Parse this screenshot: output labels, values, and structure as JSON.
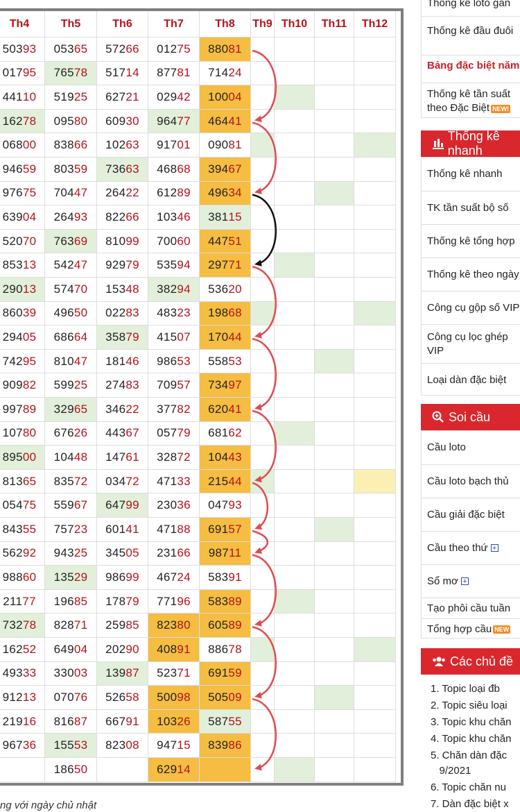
{
  "table": {
    "headers": [
      "Th4",
      "Th5",
      "Th6",
      "Th7",
      "Th8",
      "Th9",
      "Th10",
      "Th11",
      "Th12"
    ],
    "rows": [
      [
        {
          "v": "50393",
          "h": ""
        },
        {
          "v": "05365",
          "h": ""
        },
        {
          "v": "57266",
          "h": ""
        },
        {
          "v": "01275",
          "h": ""
        },
        {
          "v": "88081",
          "h": "gold"
        }
      ],
      [
        {
          "v": "01795",
          "h": ""
        },
        {
          "v": "76578",
          "h": "green"
        },
        {
          "v": "51714",
          "h": ""
        },
        {
          "v": "87781",
          "h": ""
        },
        {
          "v": "71424",
          "h": ""
        }
      ],
      [
        {
          "v": "44110",
          "h": ""
        },
        {
          "v": "51925",
          "h": ""
        },
        {
          "v": "62721",
          "h": ""
        },
        {
          "v": "02942",
          "h": ""
        },
        {
          "v": "10004",
          "h": "gold"
        }
      ],
      [
        {
          "v": "16278",
          "h": "green"
        },
        {
          "v": "09580",
          "h": ""
        },
        {
          "v": "60930",
          "h": ""
        },
        {
          "v": "96477",
          "h": "green"
        },
        {
          "v": "46441",
          "h": "gold"
        }
      ],
      [
        {
          "v": "06800",
          "h": ""
        },
        {
          "v": "83866",
          "h": ""
        },
        {
          "v": "10263",
          "h": ""
        },
        {
          "v": "91701",
          "h": ""
        },
        {
          "v": "09081",
          "h": ""
        }
      ],
      [
        {
          "v": "94659",
          "h": ""
        },
        {
          "v": "80359",
          "h": ""
        },
        {
          "v": "73663",
          "h": "green"
        },
        {
          "v": "46868",
          "h": ""
        },
        {
          "v": "39467",
          "h": "gold"
        }
      ],
      [
        {
          "v": "97675",
          "h": ""
        },
        {
          "v": "70447",
          "h": ""
        },
        {
          "v": "26422",
          "h": ""
        },
        {
          "v": "61289",
          "h": ""
        },
        {
          "v": "49634",
          "h": "gold"
        }
      ],
      [
        {
          "v": "63904",
          "h": ""
        },
        {
          "v": "26493",
          "h": ""
        },
        {
          "v": "82266",
          "h": ""
        },
        {
          "v": "10346",
          "h": ""
        },
        {
          "v": "38115",
          "h": "green"
        }
      ],
      [
        {
          "v": "52070",
          "h": ""
        },
        {
          "v": "76369",
          "h": "green"
        },
        {
          "v": "81099",
          "h": ""
        },
        {
          "v": "70060",
          "h": ""
        },
        {
          "v": "44751",
          "h": "gold"
        }
      ],
      [
        {
          "v": "85313",
          "h": ""
        },
        {
          "v": "54247",
          "h": ""
        },
        {
          "v": "92979",
          "h": ""
        },
        {
          "v": "53594",
          "h": ""
        },
        {
          "v": "29771",
          "h": "gold"
        }
      ],
      [
        {
          "v": "29013",
          "h": "green"
        },
        {
          "v": "57470",
          "h": ""
        },
        {
          "v": "15348",
          "h": ""
        },
        {
          "v": "38294",
          "h": "green"
        },
        {
          "v": "53620",
          "h": ""
        }
      ],
      [
        {
          "v": "86039",
          "h": ""
        },
        {
          "v": "49650",
          "h": ""
        },
        {
          "v": "02283",
          "h": ""
        },
        {
          "v": "48323",
          "h": ""
        },
        {
          "v": "19868",
          "h": "gold"
        }
      ],
      [
        {
          "v": "29405",
          "h": ""
        },
        {
          "v": "68664",
          "h": ""
        },
        {
          "v": "35879",
          "h": "green"
        },
        {
          "v": "41507",
          "h": ""
        },
        {
          "v": "17044",
          "h": "gold"
        }
      ],
      [
        {
          "v": "74295",
          "h": ""
        },
        {
          "v": "81047",
          "h": ""
        },
        {
          "v": "18146",
          "h": ""
        },
        {
          "v": "98653",
          "h": ""
        },
        {
          "v": "55853",
          "h": ""
        }
      ],
      [
        {
          "v": "90982",
          "h": ""
        },
        {
          "v": "59925",
          "h": ""
        },
        {
          "v": "27483",
          "h": ""
        },
        {
          "v": "70957",
          "h": ""
        },
        {
          "v": "73497",
          "h": "gold"
        }
      ],
      [
        {
          "v": "99789",
          "h": ""
        },
        {
          "v": "32965",
          "h": "green"
        },
        {
          "v": "34622",
          "h": ""
        },
        {
          "v": "37782",
          "h": ""
        },
        {
          "v": "62041",
          "h": "gold"
        }
      ],
      [
        {
          "v": "10780",
          "h": ""
        },
        {
          "v": "67626",
          "h": ""
        },
        {
          "v": "44367",
          "h": ""
        },
        {
          "v": "05779",
          "h": ""
        },
        {
          "v": "68162",
          "h": ""
        }
      ],
      [
        {
          "v": "89500",
          "h": "green"
        },
        {
          "v": "10448",
          "h": ""
        },
        {
          "v": "14761",
          "h": ""
        },
        {
          "v": "32872",
          "h": ""
        },
        {
          "v": "10443",
          "h": "gold"
        }
      ],
      [
        {
          "v": "81365",
          "h": ""
        },
        {
          "v": "83572",
          "h": ""
        },
        {
          "v": "03472",
          "h": ""
        },
        {
          "v": "47133",
          "h": ""
        },
        {
          "v": "21544",
          "h": "gold"
        }
      ],
      [
        {
          "v": "05475",
          "h": ""
        },
        {
          "v": "55967",
          "h": ""
        },
        {
          "v": "64799",
          "h": "green"
        },
        {
          "v": "23036",
          "h": ""
        },
        {
          "v": "04793",
          "h": ""
        }
      ],
      [
        {
          "v": "84355",
          "h": ""
        },
        {
          "v": "75723",
          "h": ""
        },
        {
          "v": "60141",
          "h": ""
        },
        {
          "v": "47188",
          "h": ""
        },
        {
          "v": "69157",
          "h": "gold"
        }
      ],
      [
        {
          "v": "56292",
          "h": ""
        },
        {
          "v": "94325",
          "h": ""
        },
        {
          "v": "34505",
          "h": ""
        },
        {
          "v": "23166",
          "h": ""
        },
        {
          "v": "98711",
          "h": "gold"
        }
      ],
      [
        {
          "v": "98860",
          "h": ""
        },
        {
          "v": "13529",
          "h": "green"
        },
        {
          "v": "98699",
          "h": ""
        },
        {
          "v": "46724",
          "h": ""
        },
        {
          "v": "58391",
          "h": ""
        }
      ],
      [
        {
          "v": "21177",
          "h": ""
        },
        {
          "v": "19685",
          "h": ""
        },
        {
          "v": "17879",
          "h": ""
        },
        {
          "v": "77196",
          "h": ""
        },
        {
          "v": "58389",
          "h": "gold"
        }
      ],
      [
        {
          "v": "73278",
          "h": "green"
        },
        {
          "v": "82871",
          "h": ""
        },
        {
          "v": "25985",
          "h": ""
        },
        {
          "v": "82380",
          "h": "gold"
        },
        {
          "v": "60589",
          "h": "gold"
        }
      ],
      [
        {
          "v": "16252",
          "h": ""
        },
        {
          "v": "64904",
          "h": ""
        },
        {
          "v": "20290",
          "h": ""
        },
        {
          "v": "40891",
          "h": "gold"
        },
        {
          "v": "88678",
          "h": ""
        }
      ],
      [
        {
          "v": "49333",
          "h": ""
        },
        {
          "v": "33003",
          "h": ""
        },
        {
          "v": "13987",
          "h": "green"
        },
        {
          "v": "52371",
          "h": ""
        },
        {
          "v": "69159",
          "h": "gold"
        }
      ],
      [
        {
          "v": "91213",
          "h": ""
        },
        {
          "v": "07076",
          "h": ""
        },
        {
          "v": "52658",
          "h": ""
        },
        {
          "v": "50098",
          "h": "gold"
        },
        {
          "v": "50509",
          "h": "gold"
        }
      ],
      [
        {
          "v": "21916",
          "h": ""
        },
        {
          "v": "81687",
          "h": ""
        },
        {
          "v": "66791",
          "h": ""
        },
        {
          "v": "10326",
          "h": "gold"
        },
        {
          "v": "58755",
          "h": "green"
        }
      ],
      [
        {
          "v": "96736",
          "h": ""
        },
        {
          "v": "15553",
          "h": "green"
        },
        {
          "v": "82308",
          "h": ""
        },
        {
          "v": "94715",
          "h": ""
        },
        {
          "v": "83986",
          "h": "gold"
        }
      ],
      [
        {
          "v": "",
          "h": ""
        },
        {
          "v": "18650",
          "h": ""
        },
        {
          "v": "",
          "h": ""
        },
        {
          "v": "62914",
          "h": "gold"
        },
        {
          "v": "",
          "h": "gold"
        }
      ]
    ],
    "extra_highlights": [
      {
        "row": 0,
        "col": 5,
        "h": ""
      },
      {
        "row": 2,
        "col": 6,
        "h": "green"
      },
      {
        "row": 4,
        "col": 5,
        "h": "green"
      },
      {
        "row": 4,
        "col": 8,
        "h": "green"
      },
      {
        "row": 6,
        "col": 7,
        "h": "green"
      },
      {
        "row": 9,
        "col": 6,
        "h": "green"
      },
      {
        "row": 11,
        "col": 5,
        "h": "green"
      },
      {
        "row": 11,
        "col": 8,
        "h": "green"
      },
      {
        "row": 13,
        "col": 7,
        "h": "green"
      },
      {
        "row": 16,
        "col": 6,
        "h": "green"
      },
      {
        "row": 18,
        "col": 5,
        "h": "green"
      },
      {
        "row": 18,
        "col": 8,
        "h": "light"
      },
      {
        "row": 20,
        "col": 7,
        "h": "green"
      },
      {
        "row": 23,
        "col": 6,
        "h": "green"
      },
      {
        "row": 25,
        "col": 5,
        "h": "green"
      },
      {
        "row": 25,
        "col": 8,
        "h": "green"
      },
      {
        "row": 27,
        "col": 7,
        "h": "green"
      },
      {
        "row": 30,
        "col": 6,
        "h": "green"
      }
    ],
    "arrow_colors": {
      "red": "#e04a4f",
      "black": "#111111"
    }
  },
  "footnote": "ng với ngày chủ nhật",
  "sidebar": {
    "top_rows": [
      {
        "label": "Thống kê loto gan",
        "red": false
      },
      {
        "label": "Thống kê đầu đuôi",
        "red": false
      },
      {
        "label": "Bảng đặc biệt năm",
        "red": true
      },
      {
        "label": "Thống kê tần suất theo Đặc Biệt",
        "red": false,
        "badge": "NEW!"
      }
    ],
    "stats_header": "Thống kê nhanh",
    "stats_items": [
      "Thống kê nhanh",
      "TK tần suất bộ số",
      "Thống kê tổng hợp",
      "Thống kê theo ngày",
      "Công cụ gộp số VIP",
      "Công cụ lọc ghép VIP",
      "Loại dàn đặc biệt"
    ],
    "soi_header": "Soi cầu",
    "soi_items": [
      {
        "label": "Cầu loto"
      },
      {
        "label": "Cầu loto bạch thủ"
      },
      {
        "label": "Cầu giải đặc biệt"
      },
      {
        "label": "Cầu theo thứ",
        "plus": true
      },
      {
        "label": "Sổ mơ",
        "plus": true
      },
      {
        "label": "Tạo phôi cầu tuần"
      },
      {
        "label": "Tổng hợp cầu",
        "badge": "NEW"
      }
    ],
    "topics_header": "Các chủ đề",
    "topics": [
      "1. Topic loại đb",
      "2. Topic siêu loại",
      "3. Topic khu chăn",
      "4. Topic khu chăn",
      "5. Chăn dàn đặc",
      "   9/2021",
      "6. Topic chăn nu",
      "7. Dàn đặc biệt x"
    ]
  }
}
